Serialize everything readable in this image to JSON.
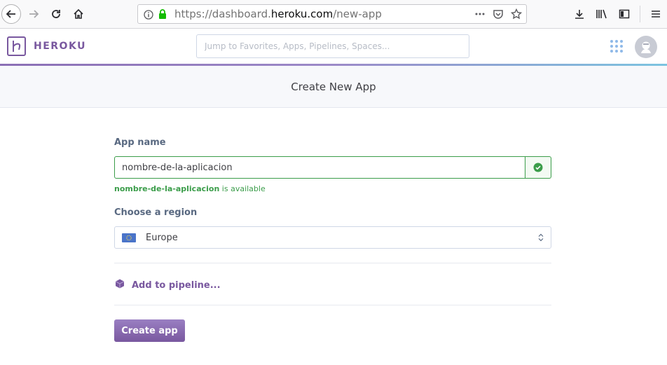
{
  "browser": {
    "url_prefix": "https://dashboard.",
    "url_host": "heroku.com",
    "url_path": "/new-app",
    "icons": [
      "back-icon",
      "forward-icon",
      "reload-icon",
      "home-icon",
      "info-icon",
      "lock-icon",
      "more-icon",
      "pocket-icon",
      "bookmark-star-icon",
      "download-icon",
      "library-icon",
      "sidebar-icon",
      "menu-icon"
    ]
  },
  "header": {
    "brand": "HEROKU",
    "search_placeholder": "Jump to Favorites, Apps, Pipelines, Spaces...",
    "brand_color": "#79589f"
  },
  "page": {
    "title": "Create New App"
  },
  "form": {
    "app_name_label": "App name",
    "app_name_value": "nombre-de-la-aplicacion",
    "availability_name": "nombre-de-la-aplicacion",
    "availability_suffix": " is available",
    "region_label": "Choose a region",
    "region_value": "Europe",
    "pipeline_label": "Add to pipeline...",
    "create_button": "Create app",
    "success_color": "#3b9d4a"
  }
}
